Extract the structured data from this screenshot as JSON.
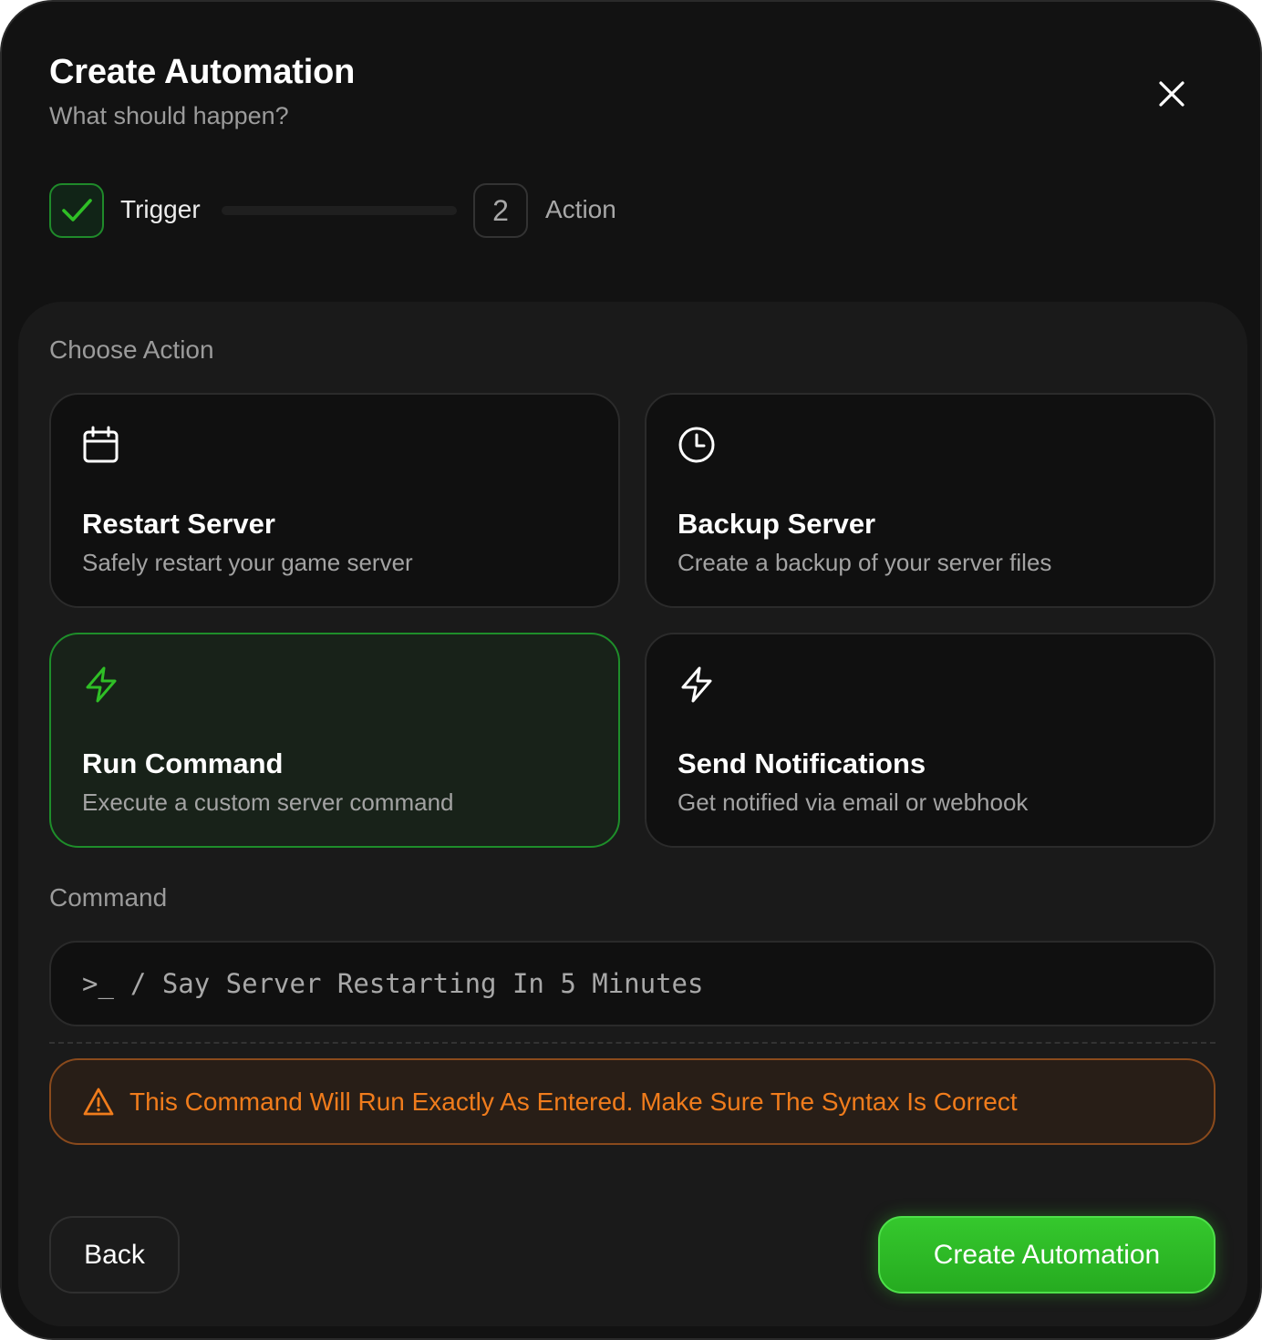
{
  "header": {
    "title": "Create Automation",
    "subtitle": "What should happen?",
    "close_icon": "close-icon"
  },
  "stepper": {
    "steps": [
      {
        "label": "Trigger",
        "state": "completed",
        "icon": "check-icon"
      },
      {
        "label": "Action",
        "number": "2",
        "state": "current"
      }
    ]
  },
  "choose_action": {
    "label": "Choose Action",
    "options": [
      {
        "title": "Restart Server",
        "description": "Safely restart your game server",
        "icon": "calendar-icon",
        "selected": false
      },
      {
        "title": "Backup Server",
        "description": "Create a backup of your server files",
        "icon": "clock-icon",
        "selected": false
      },
      {
        "title": "Run Command",
        "description": "Execute a custom server command",
        "icon": "lightning-icon",
        "selected": true
      },
      {
        "title": "Send Notifications",
        "description": "Get notified via email or webhook",
        "icon": "lightning-icon",
        "selected": false
      }
    ]
  },
  "command": {
    "label": "Command",
    "prefix": ">_",
    "value": "/ Say Server Restarting In 5 Minutes"
  },
  "warning": {
    "icon": "warning-triangle-icon",
    "text": "This Command Will Run Exactly As Entered. Make Sure The Syntax Is Correct"
  },
  "footer": {
    "back_label": "Back",
    "create_label": "Create Automation"
  },
  "colors": {
    "accent_green": "#2fbf26",
    "warning_orange": "#f07c1c",
    "background": "#121212"
  }
}
